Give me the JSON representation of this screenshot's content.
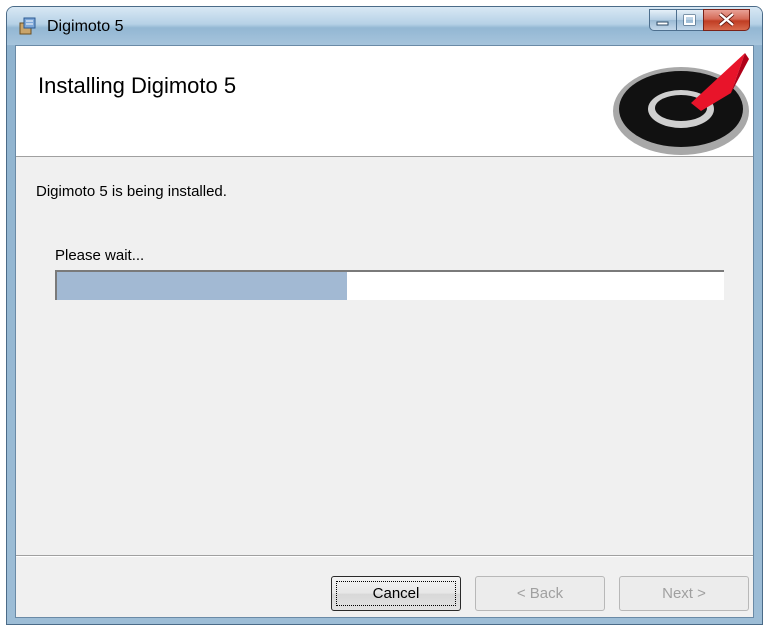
{
  "window": {
    "title": "Digimoto 5"
  },
  "banner": {
    "title": "Installing Digimoto 5"
  },
  "status": {
    "message": "Digimoto 5 is being installed.",
    "wait_label": "Please wait...",
    "progress": 0.435
  },
  "buttons": {
    "cancel": "Cancel",
    "back": "< Back",
    "next": "Next >"
  },
  "colors": {
    "progress_fill": "#a2b9d3",
    "close_button": "#c03d23",
    "logo_red": "#e8142a"
  }
}
